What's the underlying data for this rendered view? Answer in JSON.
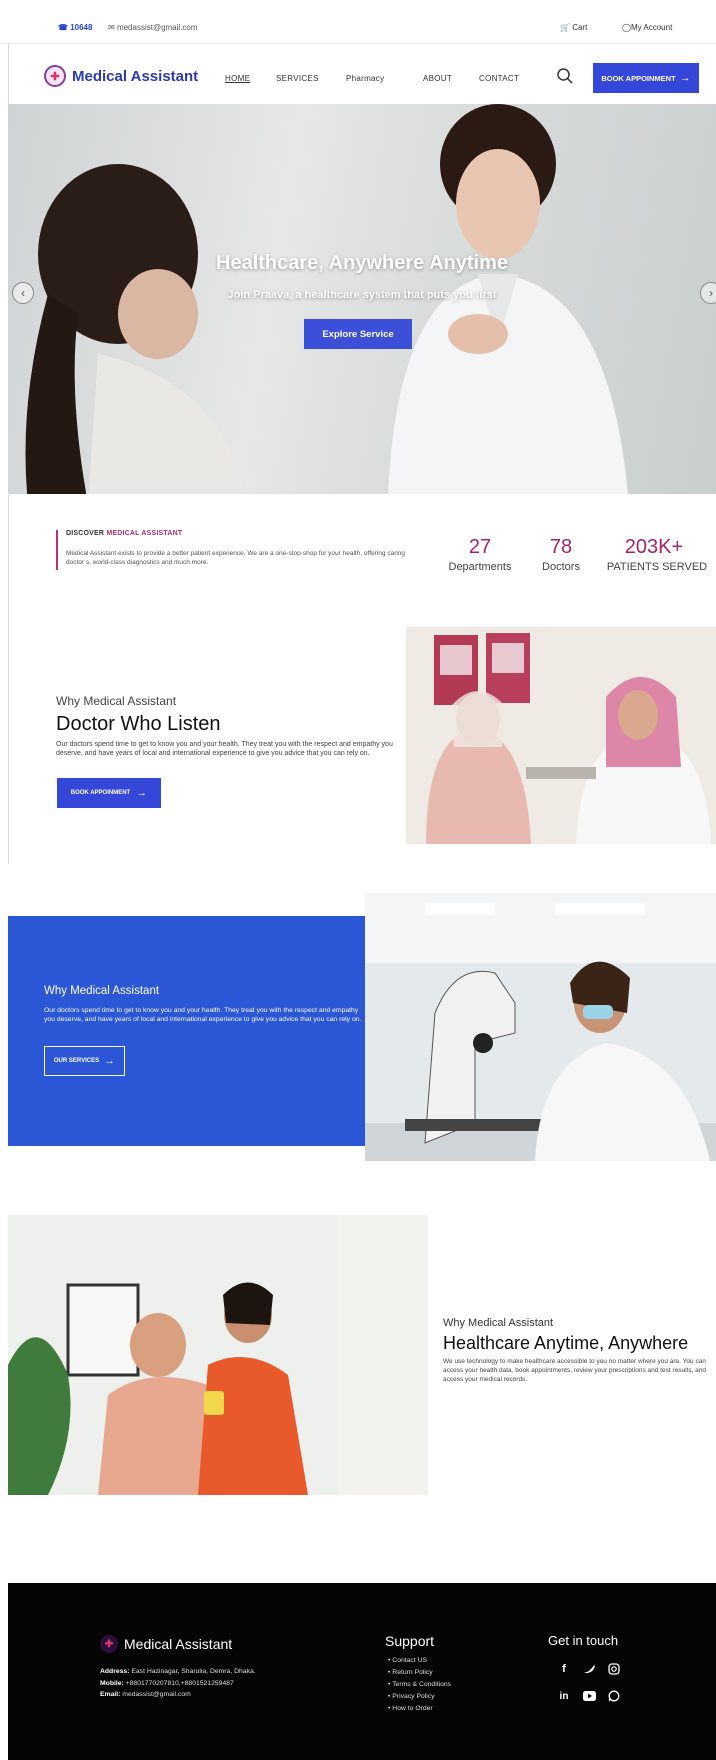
{
  "topbar": {
    "phone": "10648",
    "email": "medassist@gmail.com",
    "cart": "Cart",
    "account": "My Account"
  },
  "nav": {
    "brand": "Medical Assistant",
    "links": [
      "HOME",
      "SERVICES",
      "Pharmacy",
      "ABOUT",
      "CONTACT"
    ],
    "book_label": "BOOK APPOINMENT"
  },
  "hero": {
    "title": "Healthcare, Anywhere Anytime",
    "subtitle": "Join Praava, a healthcare system that puts you first",
    "cta": "Explore Service"
  },
  "discover": {
    "heading_prefix": "DISCOVER",
    "heading_accent": "MEDICAL ASSISTANT",
    "body": "Medical Assistant exists to provide a better patient experience. We are a one-stop-shop for your health, offering caring doctor s, world-class diagnostics and much more.",
    "stats": [
      {
        "value": "27",
        "label": "Departments"
      },
      {
        "value": "78",
        "label": "Doctors"
      },
      {
        "value": "203K+",
        "label": "PATIENTS SERVED"
      }
    ]
  },
  "listen": {
    "kicker": "Why Medical Assistant",
    "title": "Doctor Who Listen",
    "body": "Our doctors spend time to get to know you and your health. They treat you with the respect and empathy you deserve, and have years of local and international experience to give you advice that you can rely on.",
    "button": "BOOK APPOINMENT"
  },
  "blue": {
    "kicker": "Why Medical Assistant",
    "body": "Our doctors spend time to get to know you and your health. They treat you with the respect and empathy you deserve, and have years of local and international experience to give you advice that you can rely on.",
    "button": "OUR SERVICES"
  },
  "anywhere": {
    "kicker": "Why Medical Assistant",
    "title": "Healthcare Anytime, Anywhere",
    "body": "We use technology to make healthcare accessible to you no matter where you are. You can access your health data, book appointments, review your prescriptions and test results, and access your medical records."
  },
  "footer": {
    "brand": "Medical Assistant",
    "address_label": "Address:",
    "address": "East Hazinagar, Sharulia, Demra, Dhaka.",
    "mobile_label": "Mobile:",
    "mobile": "+8801770207810,+8801521259487",
    "email_label": "Email:",
    "email": "medassist@gmail.com",
    "support_title": "Support",
    "support_links": [
      "Contact US",
      "Return Policy",
      "Terms & Conditions",
      "Privacy Policy",
      "How to Order"
    ],
    "touch_title": "Get in touch"
  },
  "colors": {
    "primary": "#3547d9",
    "accent": "#a2246b",
    "blue_panel": "#2b57d6",
    "footer_bg": "#050505"
  }
}
